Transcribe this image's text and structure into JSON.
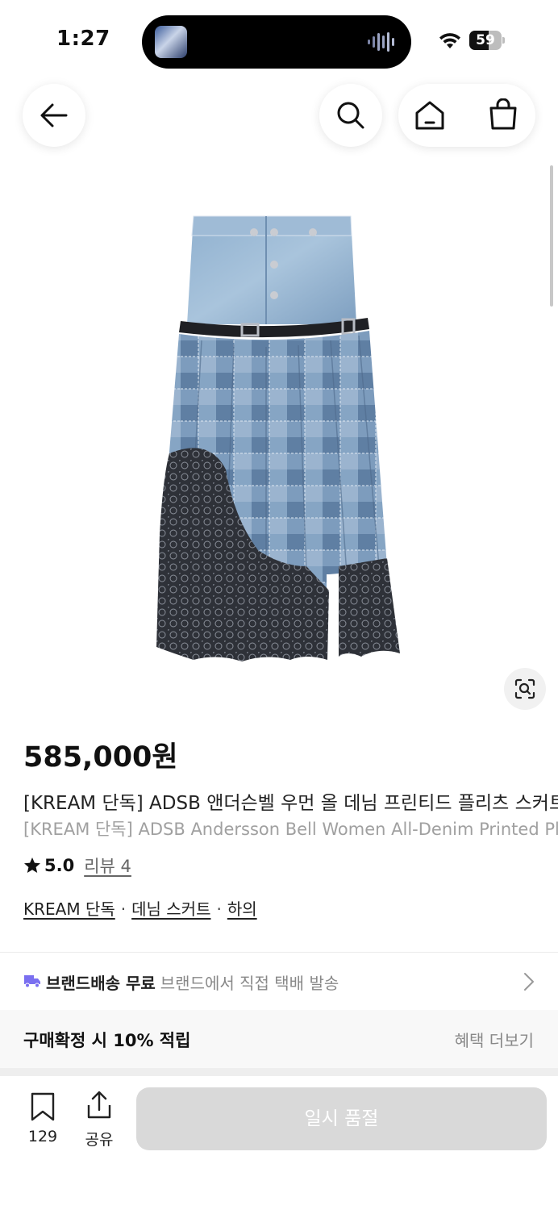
{
  "status_bar": {
    "time": "1:27",
    "battery_level": "59"
  },
  "product": {
    "price": "585,000원",
    "title_ko": "[KREAM 단독] ADSB 앤더슨벨 우먼 올 데님 프린티드 플리츠 스커트",
    "title_en": "[KREAM 단독] ADSB Andersson Bell Women All-Denim Printed Pleats Skirt",
    "rating": "5.0",
    "reviews_label": "리뷰 4",
    "tags": [
      "KREAM 단독",
      "데님 스커트",
      "하의"
    ],
    "tag_separator": "·"
  },
  "shipping": {
    "label": "브랜드배송 무료",
    "desc": "브랜드에서 직접 택배 발송"
  },
  "benefit": {
    "title": "구매확정 시 10% 적립",
    "more": "혜택 더보기"
  },
  "bottom_bar": {
    "wish_count": "129",
    "share_label": "공유",
    "buy_label": "일시 품절"
  },
  "colors": {
    "accent_truck": "#7a6ff0",
    "buy_button_disabled": "#d9d9d9"
  },
  "icons": [
    "back-arrow-icon",
    "search-icon",
    "home-icon",
    "shopping-bag-icon",
    "lens-search-icon",
    "truck-icon",
    "chevron-right-icon",
    "bookmark-icon",
    "share-icon"
  ]
}
